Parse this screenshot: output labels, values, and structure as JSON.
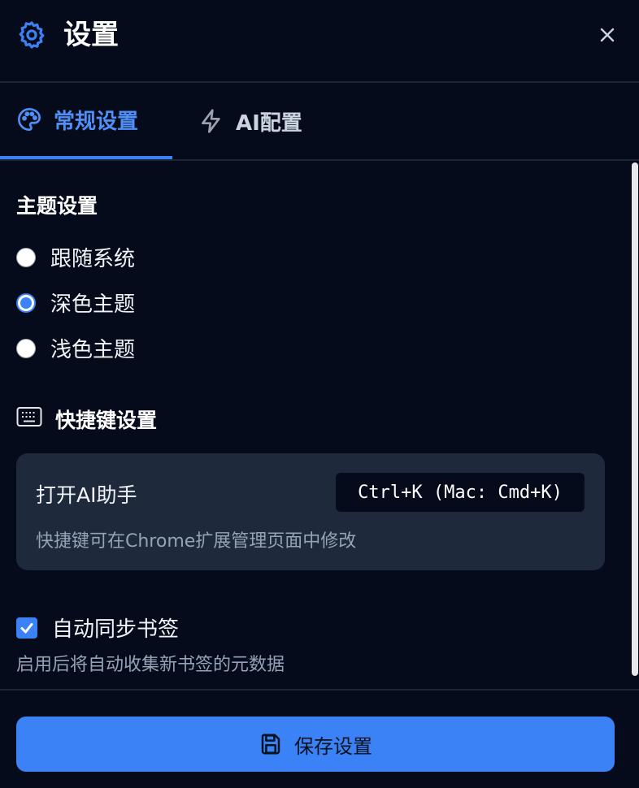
{
  "header": {
    "title": "设置",
    "icon": "gear-icon",
    "close_icon": "close-icon"
  },
  "tabs": [
    {
      "label": "常规设置",
      "icon": "palette-icon",
      "active": true
    },
    {
      "label": "AI配置",
      "icon": "lightning-icon",
      "active": false
    }
  ],
  "theme": {
    "title": "主题设置",
    "options": [
      {
        "label": "跟随系统",
        "checked": false
      },
      {
        "label": "深色主题",
        "checked": true
      },
      {
        "label": "浅色主题",
        "checked": false
      }
    ]
  },
  "shortcuts": {
    "title": "快捷键设置",
    "icon": "keyboard-icon",
    "item_label": "打开AI助手",
    "key": "Ctrl+K (Mac: Cmd+K)",
    "hint": "快捷键可在Chrome扩展管理页面中修改"
  },
  "sync": {
    "label": "自动同步书签",
    "checked": true,
    "hint": "启用后将自动收集新书签的元数据"
  },
  "footer": {
    "save_label": "保存设置",
    "icon": "save-icon"
  },
  "colors": {
    "accent": "#3b82f6",
    "background": "#050b1a",
    "card": "#1e293b"
  }
}
